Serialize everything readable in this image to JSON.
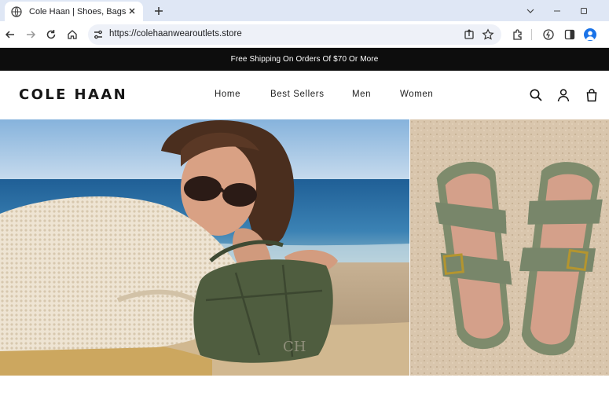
{
  "browser": {
    "tab_title": "Cole Haan | Shoes, Bags and Ac",
    "url": "https://colehaanwearoutlets.store"
  },
  "announcement": "Free Shipping On Orders Of $70 Or More",
  "site": {
    "logo": "COLE HAAN",
    "nav": [
      "Home",
      "Best Sellers",
      "Men",
      "Women"
    ]
  },
  "hero": {
    "left_image": "woman-lying-on-beach-with-green-handbag",
    "right_image": "green-strap-sandals-on-sand"
  },
  "colors": {
    "announce_bg": "#0d0d0d",
    "bag_green": "#4f5d3f",
    "sandal_green": "#7e8b6c",
    "sea_blue": "#2f73a8"
  },
  "icons": [
    "globe-icon",
    "close-icon",
    "plus-icon",
    "chevron-down-icon",
    "minimize-icon",
    "maximize-icon",
    "back-icon",
    "forward-icon",
    "reload-icon",
    "home-icon",
    "site-settings-icon",
    "share-icon",
    "star-icon",
    "extensions-icon",
    "performance-icon",
    "sidepanel-icon",
    "profile-icon",
    "search-icon",
    "account-icon",
    "bag-icon"
  ]
}
